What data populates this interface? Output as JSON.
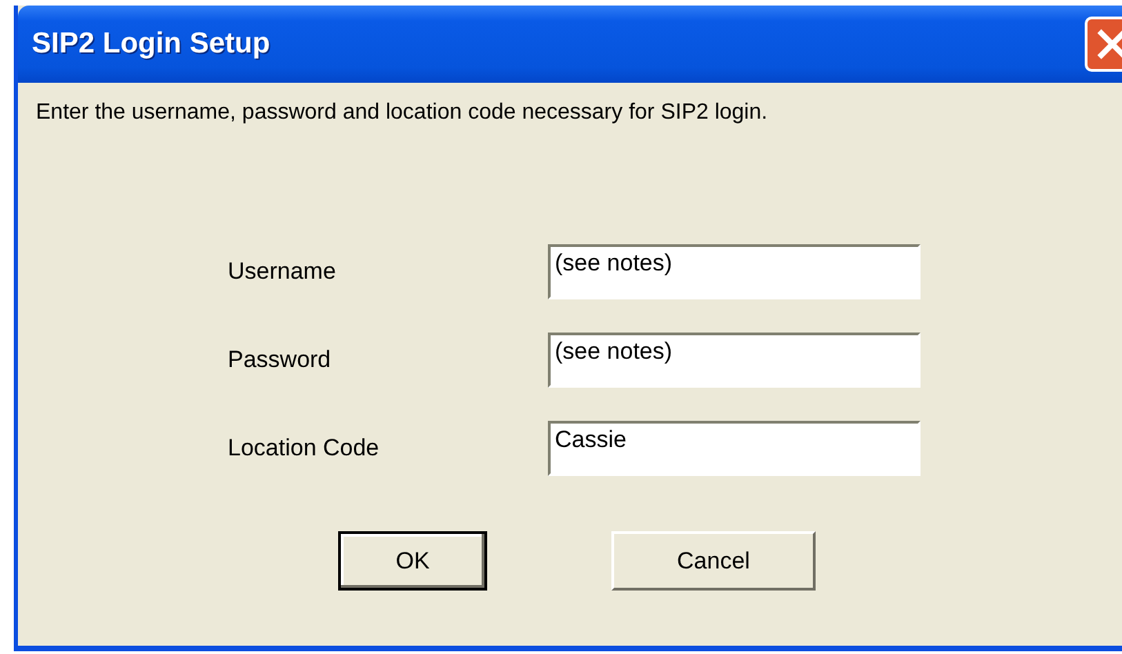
{
  "window": {
    "title": "SIP2 Login Setup"
  },
  "instructions": "Enter the username, password and location code necessary for SIP2 login.",
  "fields": [
    {
      "label": "Username",
      "value": "(see notes)"
    },
    {
      "label": "Password",
      "value": "(see notes)"
    },
    {
      "label": "Location Code",
      "value": "Cassie"
    }
  ],
  "buttons": [
    {
      "label": "OK",
      "default": true
    },
    {
      "label": "Cancel",
      "default": false
    }
  ]
}
